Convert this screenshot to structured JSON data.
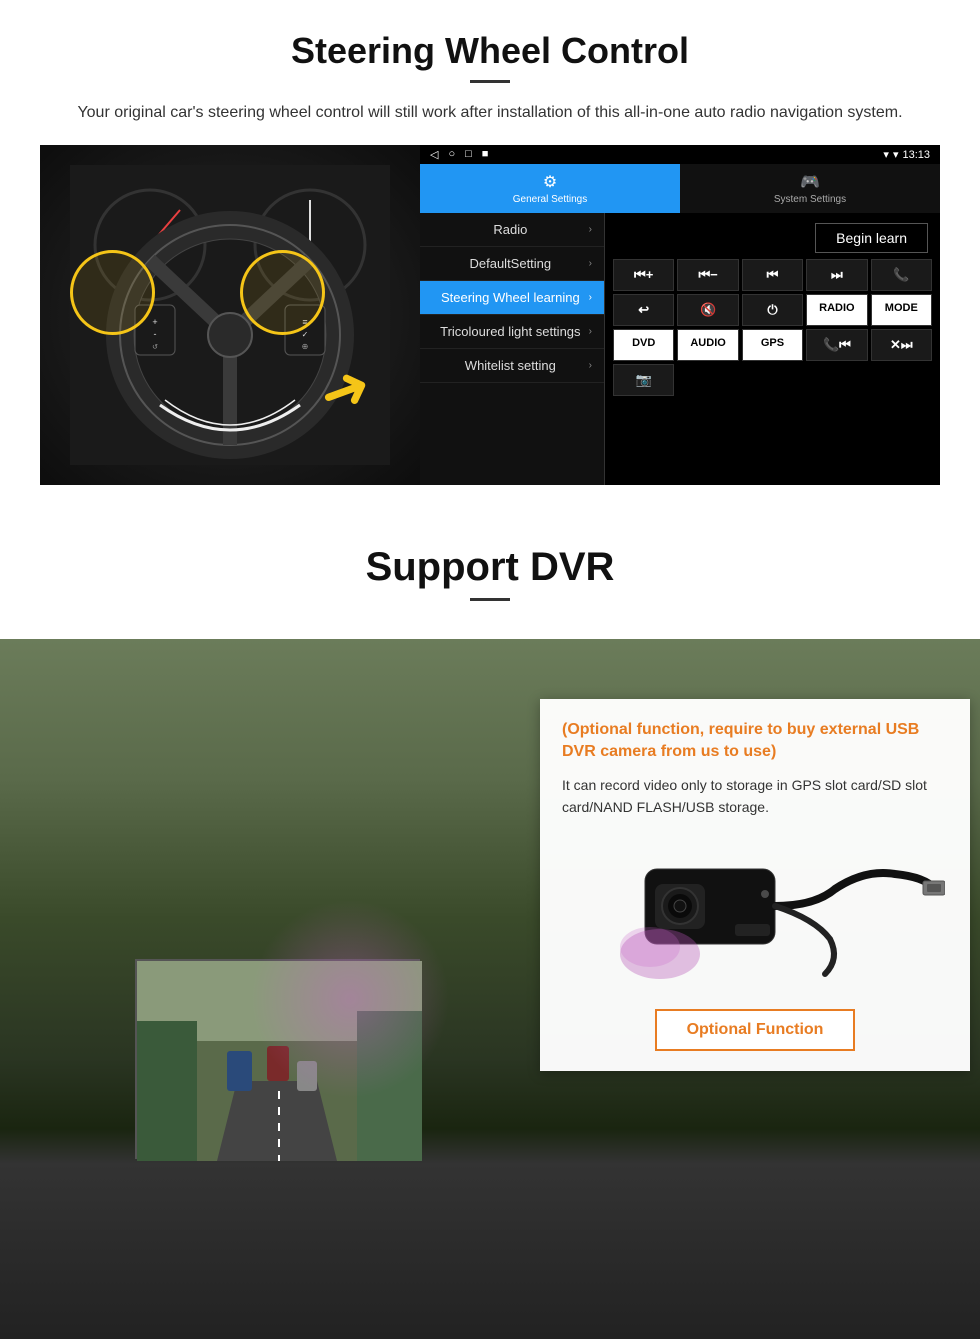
{
  "page": {
    "section1": {
      "title": "Steering Wheel Control",
      "description": "Your original car's steering wheel control will still work after installation of this all-in-one auto radio navigation system.",
      "statusbar": {
        "left_icons": [
          "◁",
          "○",
          "□",
          "■"
        ],
        "time": "13:13",
        "signal_icon": "▼",
        "wifi_icon": "▾"
      },
      "tabs": [
        {
          "icon": "⚙",
          "label": "General Settings",
          "active": true
        },
        {
          "icon": "🎮",
          "label": "System Settings",
          "active": false
        }
      ],
      "menu_items": [
        {
          "label": "Radio",
          "active": false
        },
        {
          "label": "DefaultSetting",
          "active": false
        },
        {
          "label": "Steering Wheel learning",
          "active": true
        },
        {
          "label": "Tricoloured light settings",
          "active": false
        },
        {
          "label": "Whitelist setting",
          "active": false
        }
      ],
      "begin_learn_label": "Begin learn",
      "control_buttons_row1": [
        "⏮+",
        "⏮-",
        "⏮⏮",
        "⏭⏭",
        "📞"
      ],
      "control_buttons_row2": [
        "↩",
        "🔇×",
        "⏻",
        "RADIO",
        "MODE"
      ],
      "control_buttons_row3": [
        "DVD",
        "AUDIO",
        "GPS",
        "📞⏮",
        "✕⏭"
      ],
      "control_buttons_row4": [
        "📷"
      ]
    },
    "section2": {
      "title": "Support DVR",
      "optional_text": "(Optional function, require to buy external USB DVR camera from us to use)",
      "description": "It can record video only to storage in GPS slot card/SD slot card/NAND FLASH/USB storage.",
      "optional_function_label": "Optional Function"
    }
  }
}
